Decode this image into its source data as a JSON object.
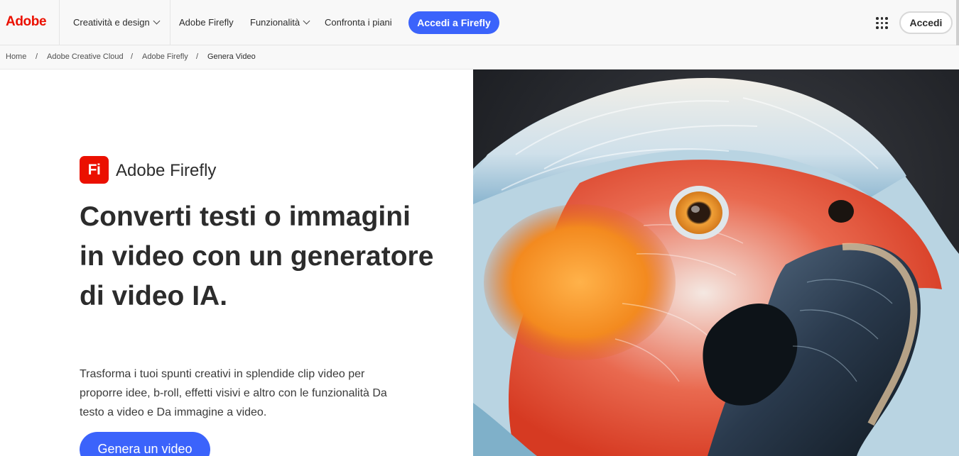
{
  "brand": {
    "logo_text": "Adobe",
    "accent": "#eb1000",
    "cta_color": "#3b63fb"
  },
  "nav": {
    "items": [
      {
        "label": "Creatività e design",
        "has_dropdown": true
      },
      {
        "label": "Adobe Firefly",
        "has_dropdown": false
      },
      {
        "label": "Funzionalità",
        "has_dropdown": true
      },
      {
        "label": "Confronta i piani",
        "has_dropdown": false
      }
    ],
    "cta_label": "Accedi a Firefly",
    "apps_icon": "apps-grid-icon",
    "signin_label": "Accedi"
  },
  "breadcrumb": {
    "items": [
      "Home",
      "Adobe Creative Cloud",
      "Adobe Firefly",
      "Genera Video"
    ],
    "separator": "/"
  },
  "hero": {
    "badge_text": "Fi",
    "product_name": "Adobe Firefly",
    "headline": "Converti testi o immagini in video con un generatore di video IA.",
    "subtext": "Trasforma i tuoi spunti creativi in splendide clip video per proporre idee, b-roll, effetti visivi e altro con le funzionalità Da testo a video e Da immagine a video.",
    "cta_label": "Genera un video",
    "image": "parrot-closeup-image"
  }
}
